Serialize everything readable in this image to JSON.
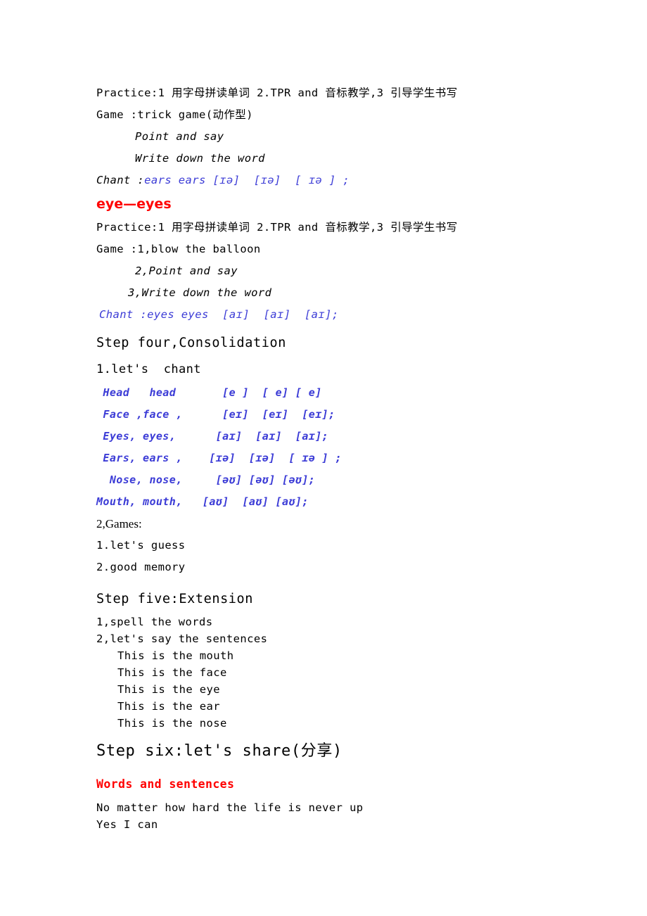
{
  "document": {
    "type": "lesson-plan",
    "colors": {
      "text": "#000000",
      "accent_blue": "#3b3bd6",
      "accent_red": "#ff0000",
      "background": "#ffffff"
    }
  },
  "section_ears": {
    "practice": "Practice:1 用字母拼读单词 2.TPR and 音标教学,3 引导学生书写",
    "game": "Game :trick game(动作型)",
    "step_point": "Point and say",
    "step_write": "Write down the word",
    "chant_label": "Chant :",
    "chant_body": "ears ears [ɪə]  [ɪə]  [ ɪə ] ;"
  },
  "heading_eye": "eye—eyes",
  "section_eyes": {
    "practice": "Practice:1 用字母拼读单词 2.TPR and 音标教学,3 引导学生书写",
    "game": "Game :1,blow the balloon",
    "step_point": "2,Point and say",
    "step_write": "3,Write down the word",
    "chant": "Chant :eyes eyes  [aɪ]  [aɪ]  [aɪ];"
  },
  "step_four": {
    "heading": "Step four,Consolidation",
    "item1": "1.let's  chant",
    "chant_rows": [
      " Head   head       [e ]  [ e] [ e]",
      " Face ,face ,      [eɪ]  [eɪ]  [eɪ];",
      " Eyes, eyes,      [aɪ]  [aɪ]  [aɪ];",
      " Ears, ears ,    [ɪə]  [ɪə]  [ ɪə ] ;",
      "  Nose, nose,     [əʊ] [əʊ] [əʊ];",
      "Mouth, mouth,   [aʊ]  [aʊ] [aʊ];"
    ],
    "item2": "2,Games:",
    "games": [
      "1.let's guess",
      "2.good memory"
    ]
  },
  "step_five": {
    "heading": "Step five:Extension",
    "item1": "1,spell the words",
    "item2": "2,let's say the sentences",
    "sentences": [
      "This is the mouth",
      "This is the face",
      "This is the eye",
      "This is the ear",
      "This is the nose"
    ]
  },
  "step_six": {
    "heading": "Step six:let's share(分享)",
    "subheading": "Words and sentences",
    "lines": [
      "No matter how hard the life is never up",
      "Yes I can"
    ]
  }
}
